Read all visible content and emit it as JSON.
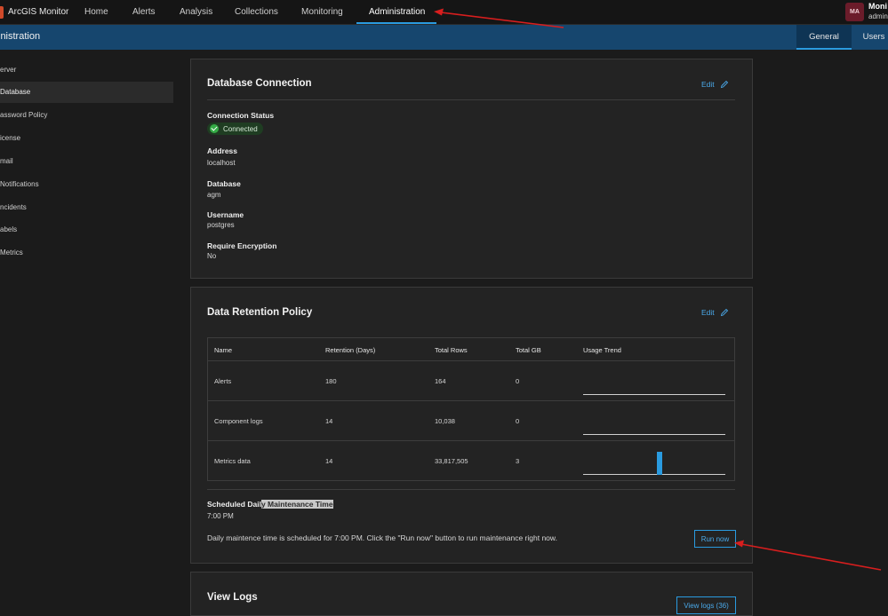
{
  "topbar": {
    "app_title": "ArcGIS Monitor",
    "nav": [
      "Home",
      "Alerts",
      "Analysis",
      "Collections",
      "Monitoring",
      "Administration"
    ],
    "active_nav": "Administration",
    "avatar_initials": "MA",
    "user_name": "Moni",
    "user_role": "admin"
  },
  "subheader": {
    "title": "inistration",
    "tabs": [
      "General",
      "Users"
    ],
    "active_tab": "General"
  },
  "sidebar": {
    "items": [
      "erver",
      "Database",
      "assword Policy",
      "icense",
      "mail",
      "Notifications",
      "ncidents",
      "abels",
      "Metrics"
    ],
    "active_item": "Database"
  },
  "database_connection": {
    "title": "Database Connection",
    "edit_label": "Edit",
    "connection_status_label": "Connection Status",
    "connection_status": "Connected",
    "address_label": "Address",
    "address": "localhost",
    "database_label": "Database",
    "database": "agm",
    "username_label": "Username",
    "username": "postgres",
    "encryption_label": "Require Encryption",
    "encryption": "No"
  },
  "data_retention": {
    "title": "Data Retention Policy",
    "edit_label": "Edit",
    "columns": [
      "Name",
      "Retention (Days)",
      "Total Rows",
      "Total GB",
      "Usage Trend"
    ],
    "rows": [
      {
        "name": "Alerts",
        "retention": "180",
        "rows": "164",
        "gb": "0",
        "trend": []
      },
      {
        "name": "Component logs",
        "retention": "14",
        "rows": "10,038",
        "gb": "0",
        "trend": []
      },
      {
        "name": "Metrics data",
        "retention": "14",
        "rows": "33,817,505",
        "gb": "3",
        "trend": [
          {
            "position": 0.52,
            "level": 0.75
          }
        ]
      }
    ],
    "schedule_label_plain": "Scheduled Dail",
    "schedule_label_highlight": "y Maintenance Time",
    "schedule_time": "7:00 PM",
    "maintenance_text": "Daily maintence time is scheduled for 7:00 PM. Click the \"Run now\" button to run maintenance right now.",
    "run_now_label": "Run now"
  },
  "view_logs": {
    "title": "View Logs",
    "button_label": "View logs (36)"
  },
  "colors": {
    "accent": "#2a9be0",
    "subheader_bg": "#16466e",
    "annotation_arrow": "#d81e1e",
    "success": "#35ac46"
  }
}
